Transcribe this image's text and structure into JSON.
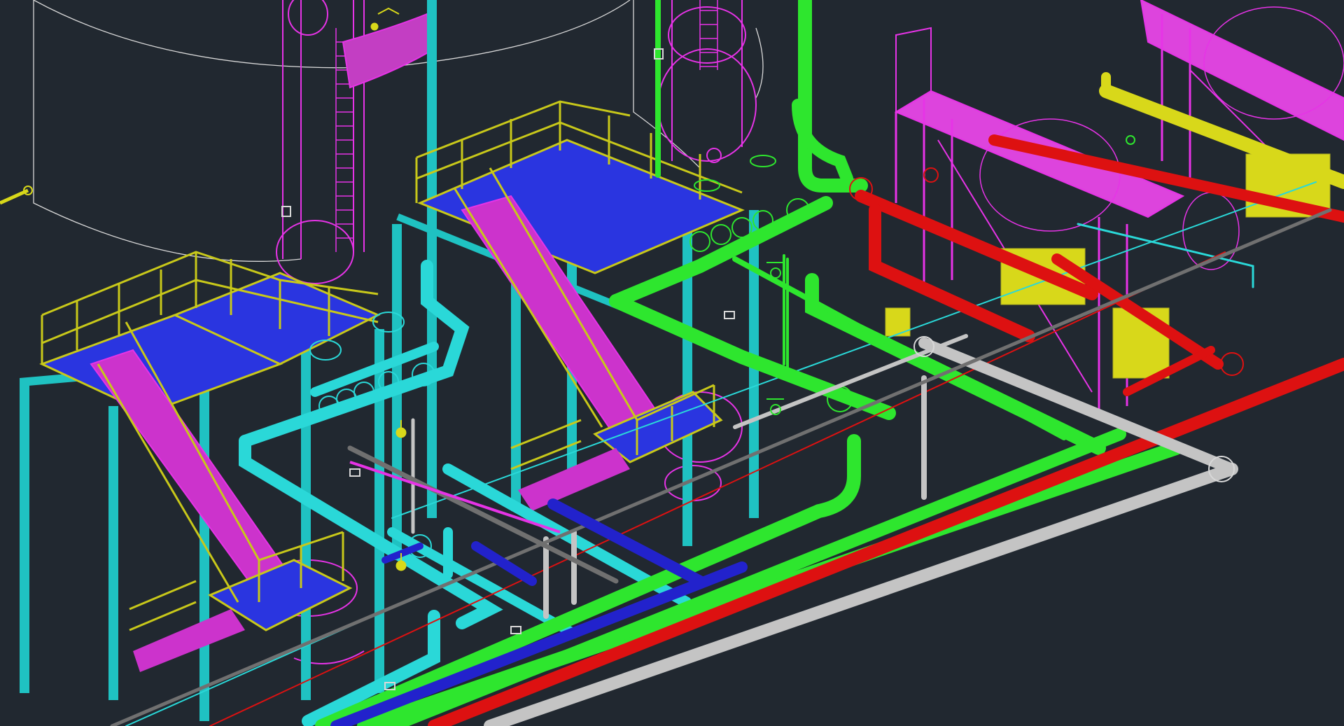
{
  "scene": {
    "background": "#212830",
    "layer_colors": {
      "structure": "#1fc2c2",
      "platform": "#e633e6",
      "handrail": "#c8c81a",
      "grating": "#2222dd",
      "pipe_green": "#2ee62e",
      "pipe_red": "#dd1111",
      "pipe_grey": "#c4c4c4",
      "pipe_yellow": "#d8d81a",
      "pipe_blue": "#2222cc",
      "outline": "#d8d8d8"
    }
  }
}
